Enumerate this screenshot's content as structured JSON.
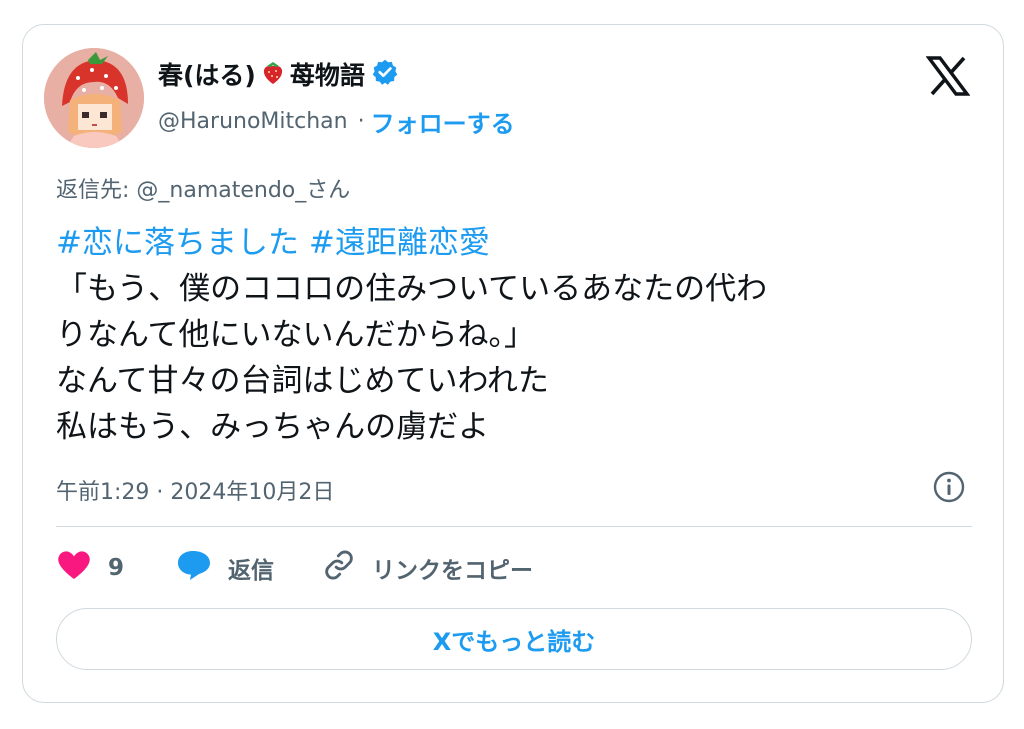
{
  "author": {
    "name": "春(はる)",
    "name_suffix": "苺物語",
    "handle": "@HarunoMitchan",
    "follow_label": "フォローする",
    "separator": "·"
  },
  "reply_to": "返信先: @_namatendo_さん",
  "tweet": {
    "hashtags": [
      "#恋に落ちました",
      "#遠距離恋愛"
    ],
    "lines": [
      "「もう、僕のココロの住みついているあなたの代わ",
      "りなんて他にいないんだからね。」",
      "なんて甘々の台詞はじめていわれた",
      "私はもう、みっちゃんの虜だよ"
    ]
  },
  "timestamp": "午前1:29 · 2024年10月2日",
  "actions": {
    "like_count": "9",
    "reply_label": "返信",
    "copy_link_label": "リンクをコピー"
  },
  "read_more_label": "Xでもっと読む",
  "icons": {
    "avatar": "pixel-art-girl-strawberry-hat-avatar",
    "strawberry": "strawberry-emoji-icon",
    "verified": "verified-badge-icon",
    "brand": "x-logo-icon",
    "info": "info-icon",
    "like": "heart-icon",
    "reply": "speech-bubble-icon",
    "link": "link-icon"
  },
  "colors": {
    "accent": "#1d9bf0",
    "text": "#0f1419",
    "secondary": "#536471",
    "border": "#cfd9de",
    "like": "#f91880"
  }
}
